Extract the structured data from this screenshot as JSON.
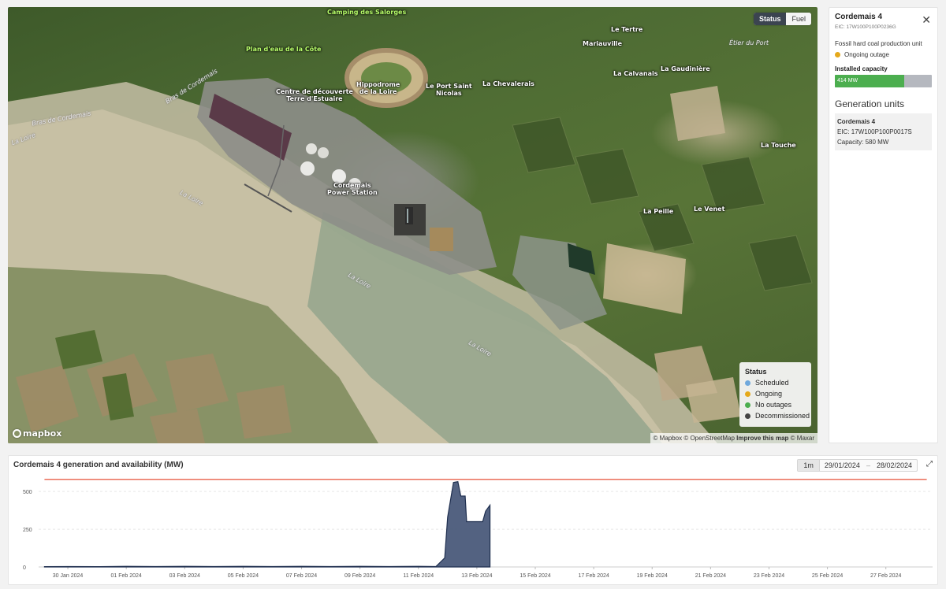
{
  "map": {
    "toggle": {
      "status_label": "Status",
      "fuel_label": "Fuel"
    },
    "labels": [
      {
        "id": "camping",
        "text": "Camping des Salorges",
        "style": "green"
      },
      {
        "id": "plan-eau",
        "text": "Plan d'eau de la Côte",
        "style": "green"
      },
      {
        "id": "le-tertre",
        "text": "Le Tertre",
        "style": "white"
      },
      {
        "id": "mariauville",
        "text": "Mariauville",
        "style": "white"
      },
      {
        "id": "etier",
        "text": "Étier du Port",
        "style": "river"
      },
      {
        "id": "hippodrome",
        "text": "Hippodrome\nde la Loire",
        "style": "white"
      },
      {
        "id": "port-saint-nicolas",
        "text": "Le Port Saint\nNicolas",
        "style": "white"
      },
      {
        "id": "chevalerais",
        "text": "La Chevalerais",
        "style": "white"
      },
      {
        "id": "calvanais",
        "text": "La Calvanais",
        "style": "white"
      },
      {
        "id": "gaudiniere",
        "text": "La Gaudinière",
        "style": "white"
      },
      {
        "id": "centre",
        "text": "Centre de découverte\nTerre d'Estuaire",
        "style": "white"
      },
      {
        "id": "bras1",
        "text": "Bras de Cordemais",
        "style": "river"
      },
      {
        "id": "bras2",
        "text": "Bras de Cordemais",
        "style": "river"
      },
      {
        "id": "la-loire-1",
        "text": "La Loire",
        "style": "river"
      },
      {
        "id": "la-loire-2",
        "text": "La Loire",
        "style": "river"
      },
      {
        "id": "la-loire-3",
        "text": "La Loire",
        "style": "river"
      },
      {
        "id": "la-loire-4",
        "text": "La Loire",
        "style": "river"
      },
      {
        "id": "cordemais-ps",
        "text": "Cordemais\nPower Station",
        "style": "white"
      },
      {
        "id": "la-touche",
        "text": "La Touche",
        "style": "white"
      },
      {
        "id": "la-peille",
        "text": "La Peille",
        "style": "white"
      },
      {
        "id": "le-venet",
        "text": "Le Venet",
        "style": "white"
      }
    ],
    "legend": {
      "title": "Status",
      "items": [
        {
          "label": "Scheduled",
          "color": "#6fa8dc"
        },
        {
          "label": "Ongoing",
          "color": "#e5a91b"
        },
        {
          "label": "No outages",
          "color": "#4cae4f"
        },
        {
          "label": "Decommissioned",
          "color": "#444444"
        }
      ]
    },
    "logo": "mapbox",
    "attribution": {
      "mapbox": "© Mapbox",
      "osm": "© OpenStreetMap",
      "improve": "Improve this map",
      "maxar": "© Maxar"
    }
  },
  "panel": {
    "title": "Cordemais 4",
    "eic": "EIC: 17W100P100P0236G",
    "fuel_type": "Fossil hard coal production unit",
    "status": "Ongoing outage",
    "status_color": "#e5a91b",
    "capacity_label": "Installed capacity",
    "capacity_text": "414  MW",
    "capacity_fraction": 0.7138,
    "generation_units_title": "Generation units",
    "units": [
      {
        "name": "Cordemais 4",
        "eic": "EIC: 17W100P100P0017S",
        "capacity": "Capacity: 580 MW"
      }
    ]
  },
  "chart": {
    "title": "Cordemais 4 generation and availability (MW)",
    "range_button": "1m",
    "date_from": "29/01/2024",
    "date_separator": "–",
    "date_to": "28/02/2024",
    "expand_icon": "expand-icon"
  },
  "chart_data": {
    "type": "area",
    "title": "Cordemais 4 generation and availability (MW)",
    "ylabel": "",
    "ylim": [
      0,
      600
    ],
    "yticks": [
      "0",
      "250",
      "500"
    ],
    "xlim_days": [
      0,
      30.6
    ],
    "xticks": [
      {
        "day": 1,
        "label": "30 Jan 2024"
      },
      {
        "day": 3,
        "label": "01 Feb 2024"
      },
      {
        "day": 5,
        "label": "03 Feb 2024"
      },
      {
        "day": 7,
        "label": "05 Feb 2024"
      },
      {
        "day": 9,
        "label": "07 Feb 2024"
      },
      {
        "day": 11,
        "label": "09 Feb 2024"
      },
      {
        "day": 13,
        "label": "11 Feb 2024"
      },
      {
        "day": 15,
        "label": "13 Feb 2024"
      },
      {
        "day": 17,
        "label": "15 Feb 2024"
      },
      {
        "day": 19,
        "label": "17 Feb 2024"
      },
      {
        "day": 21,
        "label": "19 Feb 2024"
      },
      {
        "day": 23,
        "label": "21 Feb 2024"
      },
      {
        "day": 25,
        "label": "23 Feb 2024"
      },
      {
        "day": 27,
        "label": "25 Feb 2024"
      },
      {
        "day": 29,
        "label": "27 Feb 2024"
      }
    ],
    "series": [
      {
        "name": "",
        "color": "#e8604a",
        "kind": "line",
        "points": [
          [
            0.2,
            580
          ],
          [
            30.4,
            580
          ]
        ]
      },
      {
        "name": "",
        "color": "#4a5a7a",
        "kind": "area",
        "points": [
          [
            0.2,
            2
          ],
          [
            1,
            3
          ],
          [
            2,
            2
          ],
          [
            3,
            4
          ],
          [
            4,
            3
          ],
          [
            5,
            4
          ],
          [
            6,
            3
          ],
          [
            7,
            4
          ],
          [
            8,
            3
          ],
          [
            9,
            4
          ],
          [
            10,
            3
          ],
          [
            11,
            4
          ],
          [
            12,
            3
          ],
          [
            13,
            4
          ],
          [
            13.6,
            3
          ],
          [
            13.9,
            60
          ],
          [
            14.0,
            330
          ],
          [
            14.2,
            560
          ],
          [
            14.35,
            565
          ],
          [
            14.45,
            470
          ],
          [
            14.6,
            470
          ],
          [
            14.65,
            300
          ],
          [
            14.85,
            300
          ],
          [
            15.2,
            300
          ],
          [
            15.3,
            370
          ],
          [
            15.45,
            410
          ],
          [
            15.45,
            0
          ]
        ]
      }
    ]
  }
}
